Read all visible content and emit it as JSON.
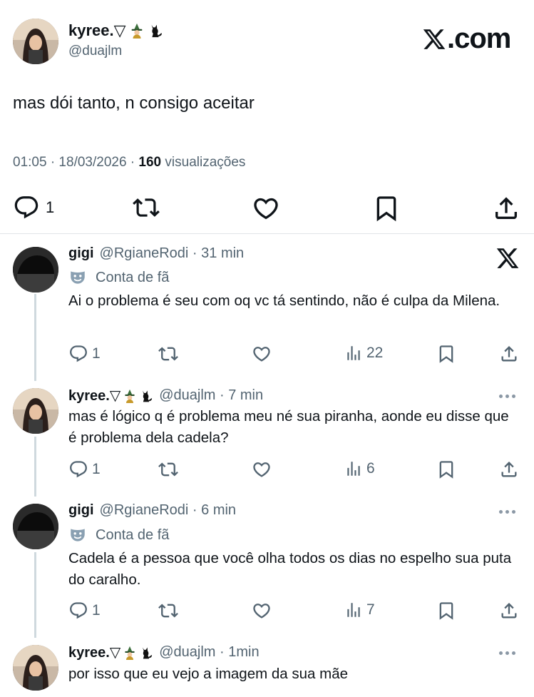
{
  "main_tweet": {
    "display_name": "kyree.▽",
    "emojis": [
      "witch-emoji",
      "black-cat-emoji"
    ],
    "handle": "@duajlm",
    "site_label": ".com",
    "text": "mas dói tanto, n consigo aceitar",
    "time": "01:05 · 18/03/2026 · ",
    "views_count": "160",
    "views_label": " visualizações",
    "reply_count": "1"
  },
  "replies": [
    {
      "display_name": "gigi",
      "handle": "@RgianeRodi · 31 min",
      "badge": "Conta de fã",
      "text": "Ai o problema é seu com oq vc tá sentindo, não é culpa da Milena.",
      "replies": "1",
      "views": "22"
    },
    {
      "display_name": "kyree.▽",
      "handle": "@duajlm · 7 min",
      "text": "mas é lógico q é problema meu né sua piranha, aonde eu disse que é problema dela cadela?",
      "replies": "1",
      "views": "6"
    },
    {
      "display_name": "gigi",
      "handle": "@RgianeRodi · 6 min",
      "badge": "Conta de fã",
      "text": "Cadela é a pessoa que você olha todos os dias no espelho sua puta do caralho.",
      "replies": "1",
      "views": "7"
    },
    {
      "display_name": "kyree.▽",
      "handle": "@duajlm · 1min",
      "text": "por isso que eu vejo a imagem da sua mãe"
    }
  ],
  "icons": {
    "reply": "speech-bubble-icon",
    "retweet": "retweet-icon",
    "like": "heart-icon",
    "bookmark": "bookmark-icon",
    "share": "share-icon",
    "views": "bar-chart-icon",
    "more": "more-dots-icon",
    "brand": "x-logo-icon"
  },
  "colors": {
    "text": "#0f1419",
    "secondary": "#536471",
    "thread_line": "#cfd9de"
  }
}
